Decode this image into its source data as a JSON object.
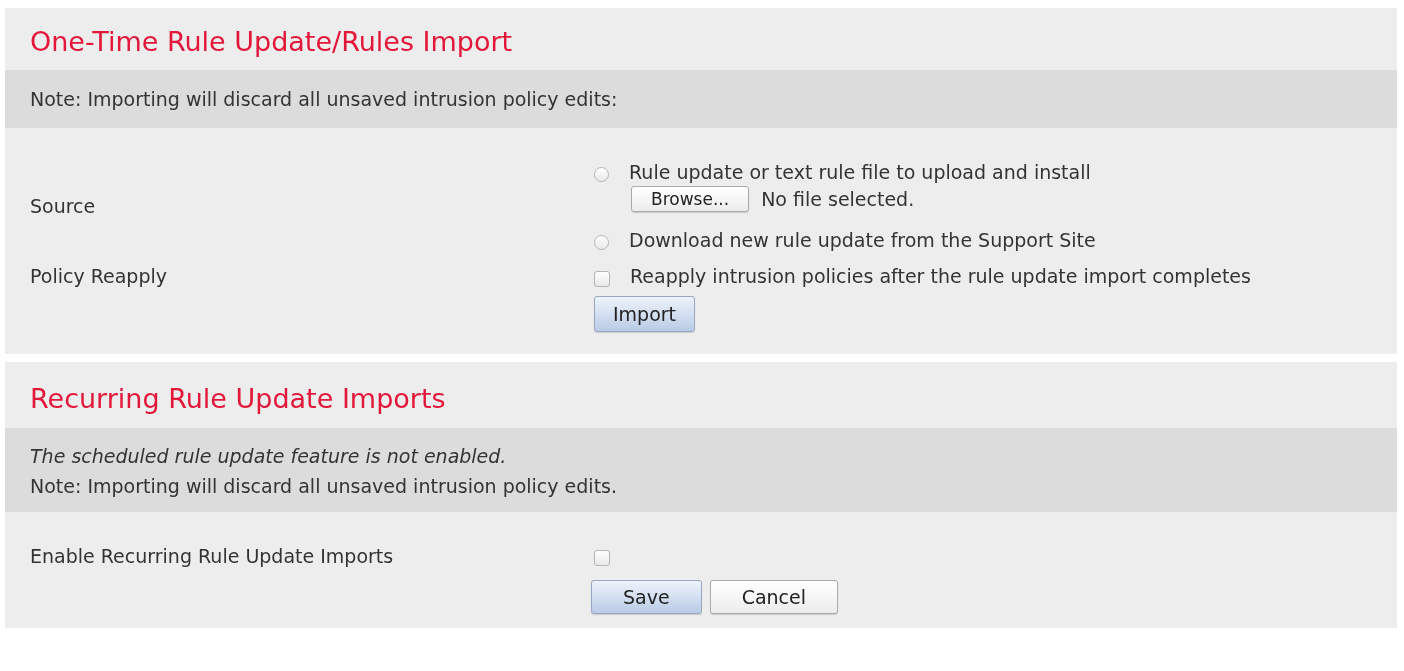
{
  "one_time_import": {
    "title": "One-Time Rule Update/Rules Import",
    "note": "Note: Importing will discard all unsaved intrusion policy edits:",
    "source": {
      "label": "Source",
      "options": [
        {
          "kind": "upload",
          "label": "Rule update or text rule file to upload and install",
          "selected": false,
          "browse_button": "Browse...",
          "file_status": "No file selected."
        },
        {
          "kind": "download",
          "label": "Download new rule update from the Support Site",
          "selected": false
        }
      ]
    },
    "policy_reapply": {
      "label": "Policy Reapply",
      "option_label": "Reapply intrusion policies after the rule update import completes",
      "checked": false
    },
    "import_button": {
      "label": "Import",
      "primary": true
    }
  },
  "recurring_imports": {
    "title": "Recurring Rule Update Imports",
    "notes": [
      {
        "text": "The scheduled rule update feature is not enabled.",
        "italic": true
      },
      {
        "text": "Note: Importing will discard all unsaved intrusion policy edits.",
        "italic": false
      }
    ],
    "enable": {
      "label": "Enable Recurring Rule Update Imports",
      "checked": false
    },
    "buttons": [
      {
        "label": "Save",
        "primary": true
      },
      {
        "label": "Cancel",
        "primary": false
      }
    ]
  }
}
